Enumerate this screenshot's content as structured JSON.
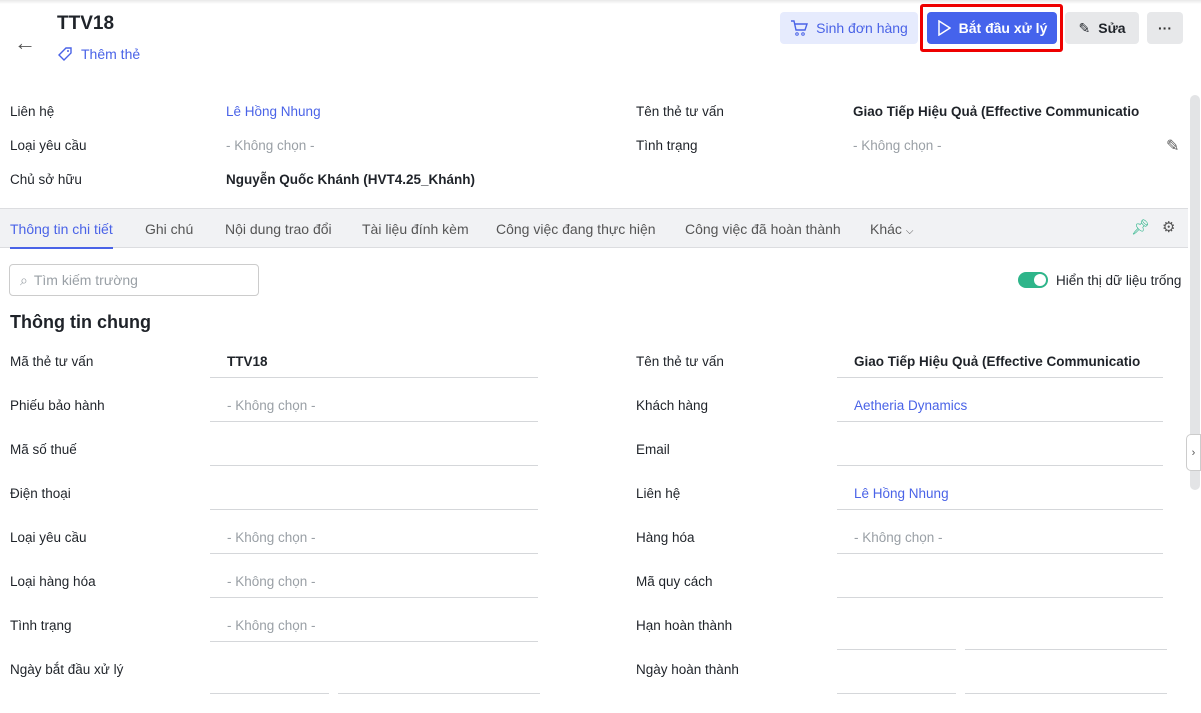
{
  "header": {
    "title": "TTV18",
    "add_tag": "Thêm thẻ",
    "buttons": {
      "create_order": "Sinh đơn hàng",
      "start_processing": "Bắt đầu xử lý",
      "edit": "Sửa",
      "more": "···"
    }
  },
  "summary": [
    {
      "label": "Liên hệ",
      "value": "Lê Hồng Nhung",
      "type": "link"
    },
    {
      "label": "Loại yêu cầu",
      "value": "- Không chọn -",
      "type": "empty"
    },
    {
      "label": "Chủ sở hữu",
      "value": "Nguyễn Quốc Khánh (HVT4.25_Khánh)",
      "type": "bold"
    },
    {
      "label": "Tên thẻ tư vấn",
      "value": "Giao Tiếp Hiệu Quả (Effective Communicatio",
      "type": "bold"
    },
    {
      "label": "Tình trạng",
      "value": "- Không chọn -",
      "type": "empty"
    }
  ],
  "tabs": [
    "Thông tin chi tiết",
    "Ghi chú",
    "Nội dung trao đổi",
    "Tài liệu đính kèm",
    "Công việc đang thực hiện",
    "Công việc đã hoàn thành",
    "Khác"
  ],
  "search": {
    "placeholder": "Tìm kiếm trường"
  },
  "show_empty": {
    "label": "Hiển thị dữ liệu trống",
    "on": true
  },
  "section_title": "Thông tin chung",
  "left_fields": [
    {
      "label": "Mã thẻ tư vấn",
      "value": "TTV18",
      "type": "bold"
    },
    {
      "label": "Phiếu bảo hành",
      "value": "- Không chọn -",
      "type": "empty"
    },
    {
      "label": "Mã số thuế",
      "value": "",
      "type": ""
    },
    {
      "label": "Điện thoại",
      "value": "",
      "type": ""
    },
    {
      "label": "Loại yêu cầu",
      "value": "- Không chọn -",
      "type": "empty"
    },
    {
      "label": "Loại hàng hóa",
      "value": "- Không chọn -",
      "type": "empty"
    },
    {
      "label": "Tình trạng",
      "value": "- Không chọn -",
      "type": "empty"
    },
    {
      "label": "Ngày bắt đầu xử lý",
      "value": "",
      "type": "split"
    }
  ],
  "right_fields": [
    {
      "label": "Tên thẻ tư vấn",
      "value": "Giao Tiếp Hiệu Quả (Effective Communicatio",
      "type": "bold"
    },
    {
      "label": "Khách hàng",
      "value": "Aetheria Dynamics",
      "type": "link"
    },
    {
      "label": "Email",
      "value": "",
      "type": ""
    },
    {
      "label": "Liên hệ",
      "value": "Lê Hồng Nhung",
      "type": "link"
    },
    {
      "label": "Hàng hóa",
      "value": "- Không chọn -",
      "type": "empty"
    },
    {
      "label": "Mã quy cách",
      "value": "",
      "type": ""
    },
    {
      "label": "Hạn hoàn thành",
      "value": "",
      "type": "split"
    },
    {
      "label": "Ngày hoàn thành",
      "value": "",
      "type": "split"
    }
  ]
}
